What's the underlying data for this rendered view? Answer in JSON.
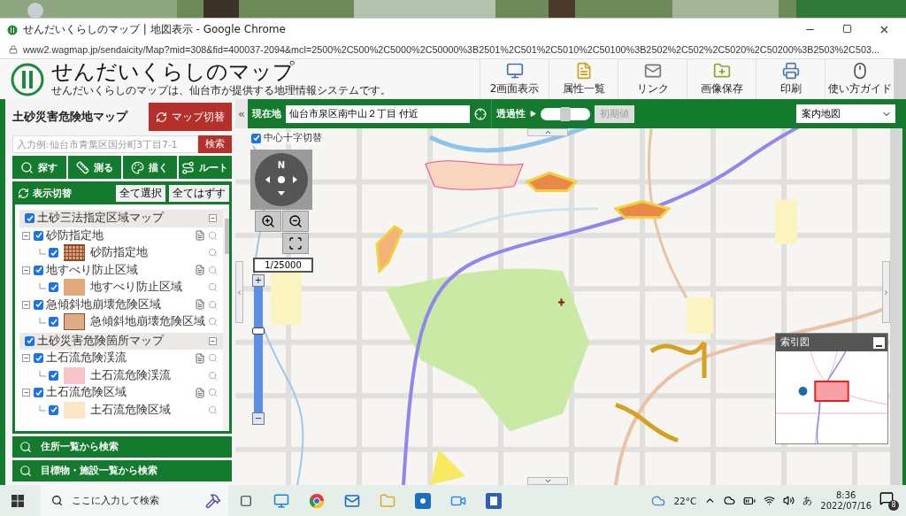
{
  "window": {
    "title": "せんだいくらしのマップ | 地図表示 - Google Chrome",
    "url": "www2.wagmap.jp/sendaicity/Map?mid=308&fid=400037-2094&mcl=2500%2C500%2C5000%2C50000%3B2501%2C501%2C5010%2C50100%3B2502%2C502%2C5020%2C50200%3B2503%2C503..."
  },
  "header": {
    "title": "せんだいくらしのマップ",
    "subtitle": "せんだいくらしのマップは、仙台市が提供する地理情報システムです。",
    "tools": [
      {
        "label": "2画面表示",
        "kind": "dual"
      },
      {
        "label": "属性一覧",
        "kind": "list"
      },
      {
        "label": "リンク",
        "kind": "link"
      },
      {
        "label": "画像保存",
        "kind": "save"
      },
      {
        "label": "印刷",
        "kind": "print"
      },
      {
        "label": "使い方ガイド",
        "kind": "guide"
      }
    ]
  },
  "sidebar": {
    "title": "土砂災害危険地マップ",
    "switch_button": "マップ切替",
    "search": {
      "placeholder": "入力例:仙台市青葉区国分町3丁目7-1",
      "button": "検索"
    },
    "tools": [
      {
        "label": "探す",
        "kind": "search"
      },
      {
        "label": "測る",
        "kind": "ruler"
      },
      {
        "label": "描く",
        "kind": "palette"
      },
      {
        "label": "ルート",
        "kind": "route"
      }
    ],
    "layers_title": "表示切替",
    "select_all": "全て選択",
    "deselect_all": "全てはずす",
    "groups": [
      {
        "label": "土砂三法指定区域マップ",
        "checked": true,
        "expanded": true,
        "children": [
          {
            "label": "砂防指定地",
            "checked": true,
            "expanded": true,
            "children": [
              {
                "label": "砂防指定地",
                "checked": true,
                "kind": "grid",
                "color": "#d9a07a"
              }
            ]
          },
          {
            "label": "地すべり防止区域",
            "checked": true,
            "expanded": true,
            "children": [
              {
                "label": "地すべり防止区域",
                "checked": true,
                "kind": "plain",
                "color": "#e2a97c"
              }
            ]
          },
          {
            "label": "急傾斜地崩壊危険区域",
            "checked": true,
            "expanded": true,
            "children": [
              {
                "label": "急傾斜地崩壊危険区域",
                "checked": true,
                "kind": "outlined",
                "color": "#deac86"
              }
            ]
          }
        ]
      },
      {
        "label": "土砂災害危険箇所マップ",
        "checked": true,
        "expanded": true,
        "children": [
          {
            "label": "土石流危険渓流",
            "checked": true,
            "expanded": true,
            "children": [
              {
                "label": "土石流危険渓流",
                "checked": true,
                "kind": "plain",
                "color": "#f8c6ca"
              }
            ]
          },
          {
            "label": "土石流危険区域",
            "checked": true,
            "expanded": true,
            "children": [
              {
                "label": "土石流危険区域",
                "checked": true,
                "kind": "plain",
                "color": "#fbe6c8"
              }
            ]
          }
        ]
      }
    ],
    "panels": [
      "住所一覧から検索",
      "目標物・施設一覧から検索"
    ]
  },
  "map_toolbar": {
    "collapse": "«",
    "location_label": "現在地",
    "location": "仙台市泉区南中山２丁目 付近",
    "opacity_label": "透過性",
    "opacity": {
      "level": 0.5
    },
    "reset_button": {
      "label": "初期値",
      "disabled": true
    },
    "basemap": "案内地図"
  },
  "map": {
    "center_cross": {
      "label": "中心十字切替",
      "checked": true
    },
    "compass": "N",
    "scale": "1/25000",
    "zoom_in": "+",
    "zoom_out": "−",
    "zoom": {
      "level": 0.65
    },
    "overview": {
      "title": "索引図"
    }
  },
  "taskbar": {
    "search_placeholder": "ここに入力して検索",
    "temperature": "22°C",
    "ime": "あ",
    "time": "8:36",
    "date": "2022/07/16",
    "notifications": "8"
  }
}
